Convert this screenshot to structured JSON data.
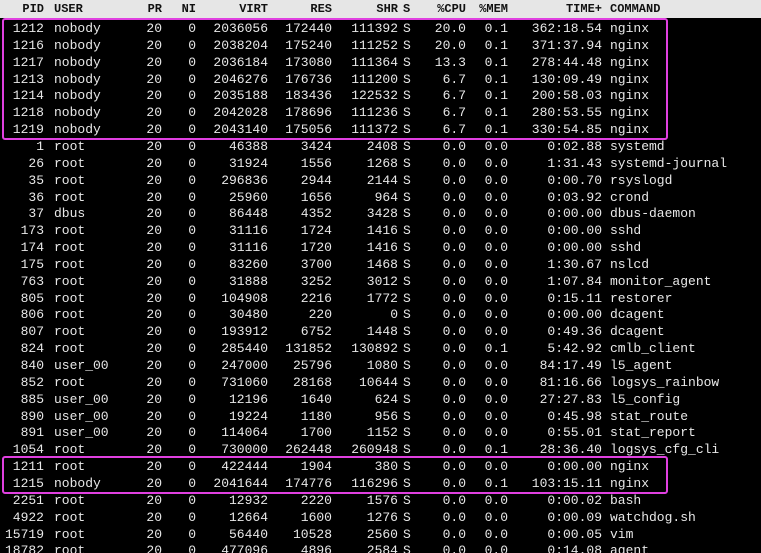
{
  "header": [
    "PID",
    "USER",
    "PR",
    "NI",
    "VIRT",
    "RES",
    "SHR",
    "S",
    "%CPU",
    "%MEM",
    "TIME+",
    "COMMAND"
  ],
  "rows": [
    [
      "1212",
      "nobody",
      "20",
      "0",
      "2036056",
      "172440",
      "111392",
      "S",
      "20.0",
      "0.1",
      "362:18.54",
      "nginx"
    ],
    [
      "1216",
      "nobody",
      "20",
      "0",
      "2038204",
      "175240",
      "111252",
      "S",
      "20.0",
      "0.1",
      "371:37.94",
      "nginx"
    ],
    [
      "1217",
      "nobody",
      "20",
      "0",
      "2036184",
      "173080",
      "111364",
      "S",
      "13.3",
      "0.1",
      "278:44.48",
      "nginx"
    ],
    [
      "1213",
      "nobody",
      "20",
      "0",
      "2046276",
      "176736",
      "111200",
      "S",
      "6.7",
      "0.1",
      "130:09.49",
      "nginx"
    ],
    [
      "1214",
      "nobody",
      "20",
      "0",
      "2035188",
      "183436",
      "122532",
      "S",
      "6.7",
      "0.1",
      "200:58.03",
      "nginx"
    ],
    [
      "1218",
      "nobody",
      "20",
      "0",
      "2042028",
      "178696",
      "111236",
      "S",
      "6.7",
      "0.1",
      "280:53.55",
      "nginx"
    ],
    [
      "1219",
      "nobody",
      "20",
      "0",
      "2043140",
      "175056",
      "111372",
      "S",
      "6.7",
      "0.1",
      "330:54.85",
      "nginx"
    ],
    [
      "1",
      "root",
      "20",
      "0",
      "46388",
      "3424",
      "2408",
      "S",
      "0.0",
      "0.0",
      "0:02.88",
      "systemd"
    ],
    [
      "26",
      "root",
      "20",
      "0",
      "31924",
      "1556",
      "1268",
      "S",
      "0.0",
      "0.0",
      "1:31.43",
      "systemd-journal"
    ],
    [
      "35",
      "root",
      "20",
      "0",
      "296836",
      "2944",
      "2144",
      "S",
      "0.0",
      "0.0",
      "0:00.70",
      "rsyslogd"
    ],
    [
      "36",
      "root",
      "20",
      "0",
      "25960",
      "1656",
      "964",
      "S",
      "0.0",
      "0.0",
      "0:03.92",
      "crond"
    ],
    [
      "37",
      "dbus",
      "20",
      "0",
      "86448",
      "4352",
      "3428",
      "S",
      "0.0",
      "0.0",
      "0:00.00",
      "dbus-daemon"
    ],
    [
      "173",
      "root",
      "20",
      "0",
      "31116",
      "1724",
      "1416",
      "S",
      "0.0",
      "0.0",
      "0:00.00",
      "sshd"
    ],
    [
      "174",
      "root",
      "20",
      "0",
      "31116",
      "1720",
      "1416",
      "S",
      "0.0",
      "0.0",
      "0:00.00",
      "sshd"
    ],
    [
      "175",
      "root",
      "20",
      "0",
      "83260",
      "3700",
      "1468",
      "S",
      "0.0",
      "0.0",
      "1:30.67",
      "nslcd"
    ],
    [
      "763",
      "root",
      "20",
      "0",
      "31888",
      "3252",
      "3012",
      "S",
      "0.0",
      "0.0",
      "1:07.84",
      "monitor_agent"
    ],
    [
      "805",
      "root",
      "20",
      "0",
      "104908",
      "2216",
      "1772",
      "S",
      "0.0",
      "0.0",
      "0:15.11",
      "restorer"
    ],
    [
      "806",
      "root",
      "20",
      "0",
      "30480",
      "220",
      "0",
      "S",
      "0.0",
      "0.0",
      "0:00.00",
      "dcagent"
    ],
    [
      "807",
      "root",
      "20",
      "0",
      "193912",
      "6752",
      "1448",
      "S",
      "0.0",
      "0.0",
      "0:49.36",
      "dcagent"
    ],
    [
      "824",
      "root",
      "20",
      "0",
      "285440",
      "131852",
      "130892",
      "S",
      "0.0",
      "0.1",
      "5:42.92",
      "cmlb_client"
    ],
    [
      "840",
      "user_00",
      "20",
      "0",
      "247000",
      "25796",
      "1080",
      "S",
      "0.0",
      "0.0",
      "84:17.49",
      "l5_agent"
    ],
    [
      "852",
      "root",
      "20",
      "0",
      "731060",
      "28168",
      "10644",
      "S",
      "0.0",
      "0.0",
      "81:16.66",
      "logsys_rainbow"
    ],
    [
      "885",
      "user_00",
      "20",
      "0",
      "12196",
      "1640",
      "624",
      "S",
      "0.0",
      "0.0",
      "27:27.83",
      "l5_config"
    ],
    [
      "890",
      "user_00",
      "20",
      "0",
      "19224",
      "1180",
      "956",
      "S",
      "0.0",
      "0.0",
      "0:45.98",
      "stat_route"
    ],
    [
      "891",
      "user_00",
      "20",
      "0",
      "114064",
      "1700",
      "1152",
      "S",
      "0.0",
      "0.0",
      "0:55.01",
      "stat_report"
    ],
    [
      "1054",
      "root",
      "20",
      "0",
      "730000",
      "262448",
      "260948",
      "S",
      "0.0",
      "0.1",
      "28:36.40",
      "logsys_cfg_cli"
    ],
    [
      "1211",
      "root",
      "20",
      "0",
      "422444",
      "1904",
      "380",
      "S",
      "0.0",
      "0.0",
      "0:00.00",
      "nginx"
    ],
    [
      "1215",
      "nobody",
      "20",
      "0",
      "2041644",
      "174776",
      "116296",
      "S",
      "0.0",
      "0.1",
      "103:15.11",
      "nginx"
    ],
    [
      "2251",
      "root",
      "20",
      "0",
      "12932",
      "2220",
      "1576",
      "S",
      "0.0",
      "0.0",
      "0:00.02",
      "bash"
    ],
    [
      "4922",
      "root",
      "20",
      "0",
      "12664",
      "1600",
      "1276",
      "S",
      "0.0",
      "0.0",
      "0:00.09",
      "watchdog.sh"
    ],
    [
      "15719",
      "root",
      "20",
      "0",
      "56440",
      "10528",
      "2560",
      "S",
      "0.0",
      "0.0",
      "0:00.05",
      "vim"
    ],
    [
      "18782",
      "root",
      "20",
      "0",
      "477096",
      "4896",
      "2584",
      "S",
      "0.0",
      "0.0",
      "0:14.08",
      "agent"
    ]
  ],
  "highlight_groups": [
    {
      "first_row": 0,
      "last_row": 6
    },
    {
      "first_row": 26,
      "last_row": 27
    }
  ],
  "colors": {
    "background": "#000000",
    "text": "#e8e8e8",
    "header_bg": "#e6e6e6",
    "header_text": "#111111",
    "highlight_border": "#e040e0"
  }
}
